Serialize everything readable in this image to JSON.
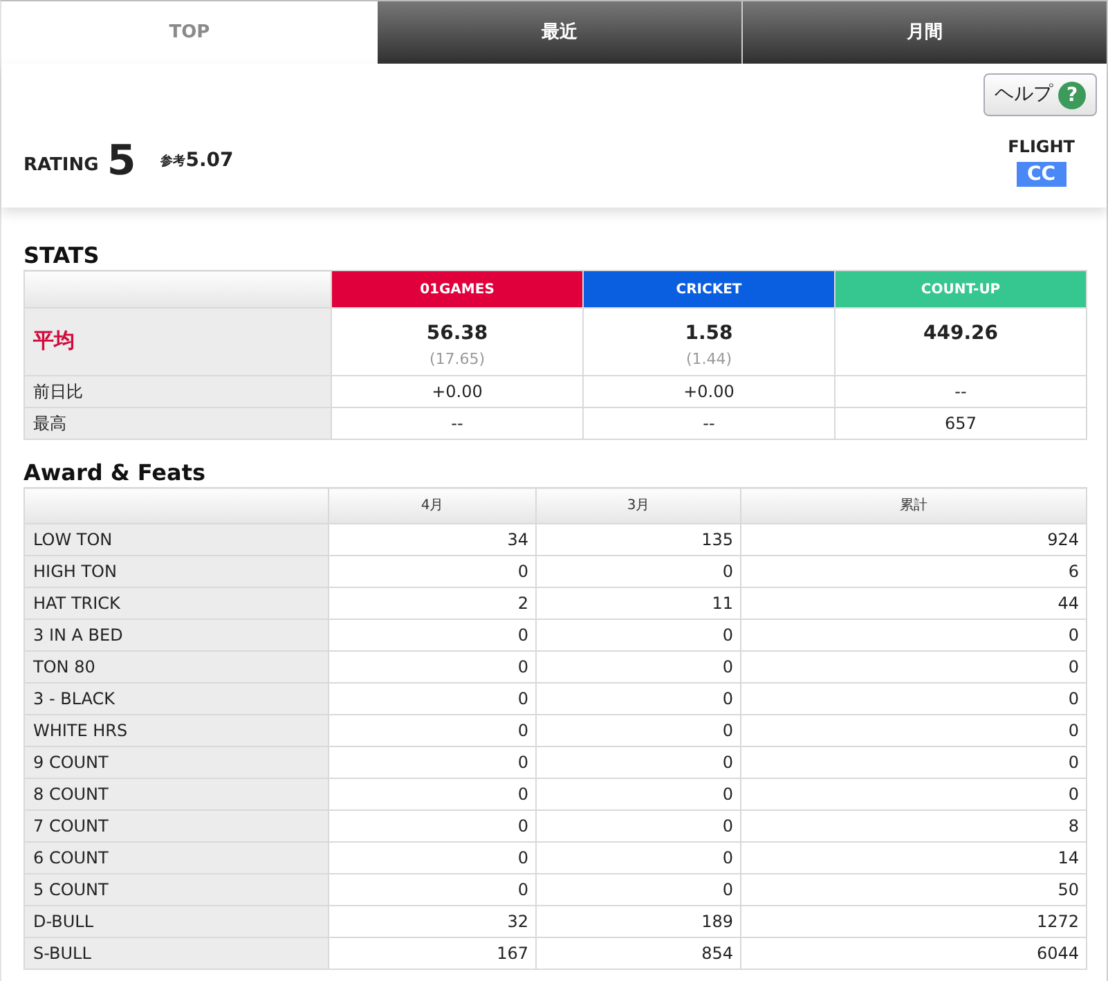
{
  "tabs": [
    {
      "label": "TOP",
      "selected": true
    },
    {
      "label": "最近",
      "selected": false
    },
    {
      "label": "月間",
      "selected": false
    }
  ],
  "help_button": {
    "label": "ヘルプ",
    "icon": "?"
  },
  "rating": {
    "label": "RATING",
    "value": "5",
    "reference_label": "参考",
    "reference_value": "5.07"
  },
  "flight": {
    "label": "FLIGHT",
    "value": "CC"
  },
  "stats": {
    "title": "STATS",
    "columns": [
      {
        "label": "01GAMES",
        "color": "#e0003c"
      },
      {
        "label": "CRICKET",
        "color": "#0a5ee0"
      },
      {
        "label": "COUNT-UP",
        "color": "#36c690"
      }
    ],
    "rows": [
      {
        "kind": "average",
        "label": "平均",
        "cells": [
          {
            "value": "56.38",
            "sub": "(17.65)"
          },
          {
            "value": "1.58",
            "sub": "(1.44)"
          },
          {
            "value": "449.26"
          }
        ]
      },
      {
        "kind": "plain",
        "label": "前日比",
        "cells": [
          {
            "value": "+0.00"
          },
          {
            "value": "+0.00"
          },
          {
            "value": "--"
          }
        ]
      },
      {
        "kind": "plain",
        "label": "最高",
        "cells": [
          {
            "value": "--"
          },
          {
            "value": "--"
          },
          {
            "value": "657"
          }
        ]
      }
    ]
  },
  "awards": {
    "title": "Award & Feats",
    "columns": [
      "4月",
      "3月",
      "累計"
    ],
    "rows": [
      {
        "label": "LOW TON",
        "values": [
          "34",
          "135",
          "924"
        ]
      },
      {
        "label": "HIGH TON",
        "values": [
          "0",
          "0",
          "6"
        ]
      },
      {
        "label": "HAT TRICK",
        "values": [
          "2",
          "11",
          "44"
        ]
      },
      {
        "label": "3 IN A BED",
        "values": [
          "0",
          "0",
          "0"
        ]
      },
      {
        "label": "TON 80",
        "values": [
          "0",
          "0",
          "0"
        ]
      },
      {
        "label": "3 - BLACK",
        "values": [
          "0",
          "0",
          "0"
        ]
      },
      {
        "label": "WHITE HRS",
        "values": [
          "0",
          "0",
          "0"
        ]
      },
      {
        "label": "9 COUNT",
        "values": [
          "0",
          "0",
          "0"
        ]
      },
      {
        "label": "8 COUNT",
        "values": [
          "0",
          "0",
          "0"
        ]
      },
      {
        "label": "7 COUNT",
        "values": [
          "0",
          "0",
          "8"
        ]
      },
      {
        "label": "6 COUNT",
        "values": [
          "0",
          "0",
          "14"
        ]
      },
      {
        "label": "5 COUNT",
        "values": [
          "0",
          "0",
          "50"
        ]
      },
      {
        "label": "D-BULL",
        "values": [
          "32",
          "189",
          "1272"
        ]
      },
      {
        "label": "S-BULL",
        "values": [
          "167",
          "854",
          "6044"
        ]
      }
    ]
  }
}
